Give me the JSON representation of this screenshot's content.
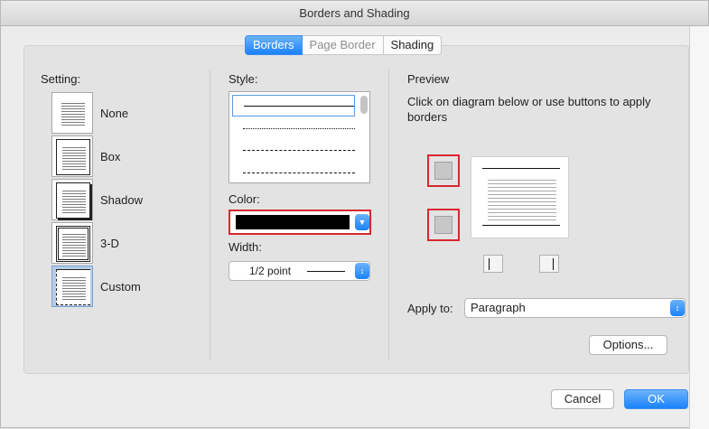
{
  "window": {
    "title": "Borders and Shading"
  },
  "tabs": [
    {
      "label": "Borders",
      "state": "active"
    },
    {
      "label": "Page Border",
      "state": "dim"
    },
    {
      "label": "Shading",
      "state": "normal"
    }
  ],
  "setting": {
    "label": "Setting:",
    "options": [
      {
        "label": "None"
      },
      {
        "label": "Box"
      },
      {
        "label": "Shadow"
      },
      {
        "label": "3-D"
      },
      {
        "label": "Custom"
      }
    ],
    "selected": "Custom"
  },
  "style": {
    "label": "Style:"
  },
  "color": {
    "label": "Color:",
    "value": "#000000"
  },
  "width": {
    "label": "Width:",
    "value": "1/2 point"
  },
  "preview": {
    "label": "Preview",
    "instructions": "Click on diagram below or use buttons to apply borders"
  },
  "apply_to": {
    "label": "Apply to:",
    "value": "Paragraph"
  },
  "buttons": {
    "options": "Options...",
    "cancel": "Cancel",
    "ok": "OK"
  },
  "colors": {
    "accent": "#1a82fb",
    "highlight": "#d7282f"
  }
}
